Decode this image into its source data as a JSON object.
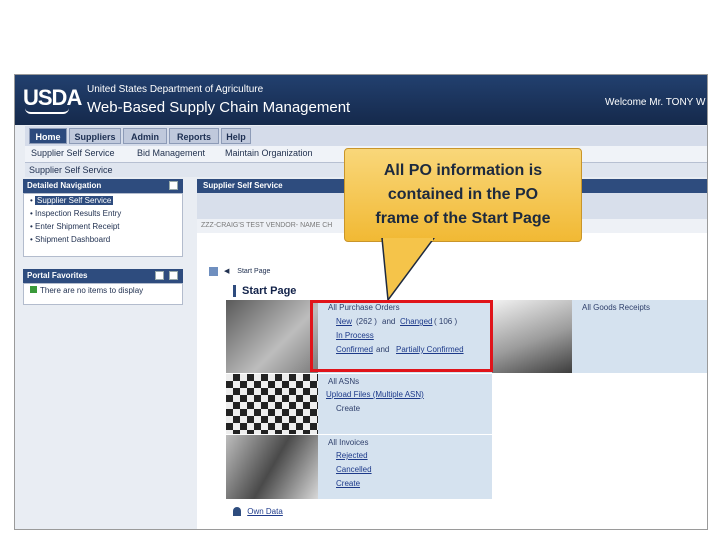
{
  "header": {
    "logo": "USDA",
    "department": "United States Department of Agriculture",
    "app_title": "Web-Based Supply Chain Management",
    "welcome": "Welcome Mr. TONY W"
  },
  "topnav": [
    "Home",
    "Suppliers",
    "Admin",
    "Reports",
    "Help"
  ],
  "subnav": [
    "Supplier Self Service",
    "Bid Management",
    "Maintain Organization"
  ],
  "breadcrumb": "Supplier Self Service",
  "detailed_nav": {
    "title": "Detailed Navigation",
    "items": [
      "Supplier Self Service",
      "Inspection Results Entry",
      "Enter Shipment Receipt",
      "Shipment Dashboard"
    ]
  },
  "portal_favorites": {
    "title": "Portal Favorites",
    "empty_text": "There are no items to display"
  },
  "main": {
    "header": "Supplier Self Service",
    "vendor": "ZZZ-CRAIG'S TEST VENDOR- NAME CH",
    "start_page_link": "Start Page",
    "start_page_title": "Start Page"
  },
  "po_section": {
    "title": "All Purchase Orders",
    "new_label": "New",
    "new_count": "(262 )",
    "and_text": "and",
    "changed_label": "Changed",
    "changed_count": "( 106 )",
    "in_process": "In Process",
    "confirmed": "Confirmed",
    "and_text2": "and",
    "partially_confirmed": "Partially Confirmed"
  },
  "goods_receipts": "All Goods Receipts",
  "asn_section": {
    "title": "All ASNs",
    "upload": "Upload Files (Multiple ASN)",
    "create": "Create"
  },
  "invoice_section": {
    "title": "All Invoices",
    "rejected": "Rejected",
    "cancelled": "Cancelled",
    "create": "Create"
  },
  "own_data": "Own Data",
  "callout": {
    "line1": "All PO information is",
    "line2": "contained in the PO",
    "line3": "frame of the Start Page"
  },
  "colors": {
    "banner": "#1c3560",
    "callout": "#f8c653",
    "highlight_box": "#e0141a"
  }
}
